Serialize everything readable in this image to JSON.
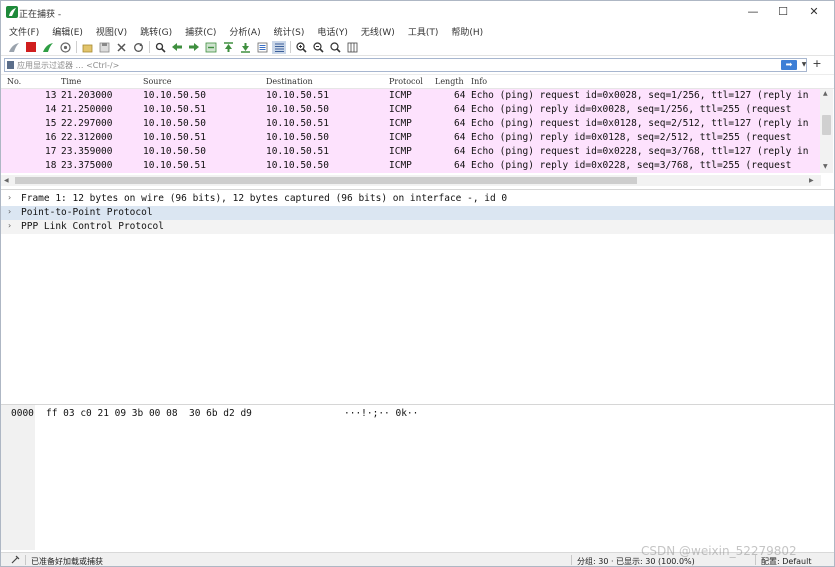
{
  "window": {
    "title": "正在捕获 -",
    "controls": {
      "minimize": "—",
      "maximize": "☐",
      "close": "✕"
    }
  },
  "menu": [
    "文件(F)",
    "编辑(E)",
    "视图(V)",
    "跳转(G)",
    "捕获(C)",
    "分析(A)",
    "统计(S)",
    "电话(Y)",
    "无线(W)",
    "工具(T)",
    "帮助(H)"
  ],
  "toolbar": {
    "icons": [
      "shark-fin-icon",
      "stop-icon",
      "restart-icon",
      "options-icon",
      "open-icon",
      "save-icon",
      "close-file-icon",
      "reload-icon",
      "find-icon",
      "back-icon",
      "forward-icon",
      "go-to-icon",
      "first-packet-icon",
      "last-packet-icon",
      "autoscroll-icon",
      "colorize-icon",
      "zoom-in-icon",
      "zoom-out-icon",
      "normal-size-icon",
      "resize-columns-icon"
    ]
  },
  "filter": {
    "placeholder": "应用显示过滤器 … <Ctrl-/>",
    "value": "",
    "add_label": "+"
  },
  "packet_list": {
    "columns": [
      "No.",
      "Time",
      "Source",
      "Destination",
      "Protocol",
      "Length",
      "Info"
    ],
    "rows": [
      {
        "no": "13",
        "time": "21.203000",
        "source": "10.10.50.50",
        "destination": "10.10.50.51",
        "protocol": "ICMP",
        "length": "64",
        "info": "Echo (ping) request  id=0x0028, seq=1/256, ttl=127 (reply in"
      },
      {
        "no": "14",
        "time": "21.250000",
        "source": "10.10.50.51",
        "destination": "10.10.50.50",
        "protocol": "ICMP",
        "length": "64",
        "info": "Echo (ping) reply    id=0x0028, seq=1/256, ttl=255 (request"
      },
      {
        "no": "15",
        "time": "22.297000",
        "source": "10.10.50.50",
        "destination": "10.10.50.51",
        "protocol": "ICMP",
        "length": "64",
        "info": "Echo (ping) request  id=0x0128, seq=2/512, ttl=127 (reply in"
      },
      {
        "no": "16",
        "time": "22.312000",
        "source": "10.10.50.51",
        "destination": "10.10.50.50",
        "protocol": "ICMP",
        "length": "64",
        "info": "Echo (ping) reply    id=0x0128, seq=2/512, ttl=255 (request"
      },
      {
        "no": "17",
        "time": "23.359000",
        "source": "10.10.50.50",
        "destination": "10.10.50.51",
        "protocol": "ICMP",
        "length": "64",
        "info": "Echo (ping) request  id=0x0228, seq=3/768, ttl=127 (reply in"
      },
      {
        "no": "18",
        "time": "23.375000",
        "source": "10.10.50.51",
        "destination": "10.10.50.50",
        "protocol": "ICMP",
        "length": "64",
        "info": "Echo (ping) reply    id=0x0228, seq=3/768, ttl=255 (request"
      }
    ],
    "row_color": "#fde2fd"
  },
  "details": [
    {
      "text": "Frame 1: 12 bytes on wire (96 bits), 12 bytes captured (96 bits) on interface -, id 0"
    },
    {
      "text": "Point-to-Point Protocol"
    },
    {
      "text": "PPP Link Control Protocol"
    }
  ],
  "bytes": {
    "offset": "0000",
    "hex": "ff 03 c0 21 09 3b 00 08  30 6b d2 d9",
    "ascii": "···!·;·· 0k··"
  },
  "status": {
    "ready": "已准备好加载或捕获",
    "packets": "分组: 30 · 已显示: 30 (100.0%)",
    "profile": "配置: Default"
  },
  "watermark": "CSDN @weixin_52279802"
}
